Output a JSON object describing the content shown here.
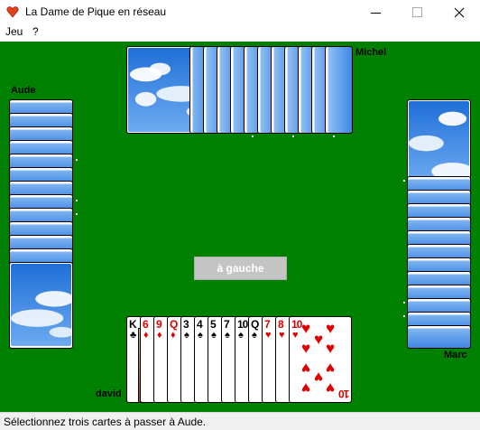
{
  "window": {
    "title": "La Dame de Pique en réseau"
  },
  "menu": {
    "items": [
      "Jeu",
      "?"
    ]
  },
  "players": {
    "north": "Michel",
    "west": "Aude",
    "east": "Marc",
    "south": "david"
  },
  "pass_button": {
    "label": "à gauche"
  },
  "hand": [
    {
      "rank": "K",
      "suit": "♣",
      "color": "black"
    },
    {
      "rank": "6",
      "suit": "♦",
      "color": "red"
    },
    {
      "rank": "9",
      "suit": "♦",
      "color": "red"
    },
    {
      "rank": "Q",
      "suit": "♦",
      "color": "red"
    },
    {
      "rank": "3",
      "suit": "♠",
      "color": "black"
    },
    {
      "rank": "4",
      "suit": "♠",
      "color": "black"
    },
    {
      "rank": "5",
      "suit": "♠",
      "color": "black"
    },
    {
      "rank": "7",
      "suit": "♠",
      "color": "black"
    },
    {
      "rank": "10",
      "suit": "♠",
      "color": "black"
    },
    {
      "rank": "Q",
      "suit": "♠",
      "color": "black"
    },
    {
      "rank": "7",
      "suit": "♥",
      "color": "red"
    },
    {
      "rank": "8",
      "suit": "♥",
      "color": "red"
    },
    {
      "rank": "10",
      "suit": "♥",
      "color": "red"
    }
  ],
  "status": {
    "text": "Sélectionnez trois cartes à passer à Aude."
  },
  "colors": {
    "table": "#008000",
    "red_suit": "#e00000",
    "button_disabled": "#c4c4c4"
  }
}
